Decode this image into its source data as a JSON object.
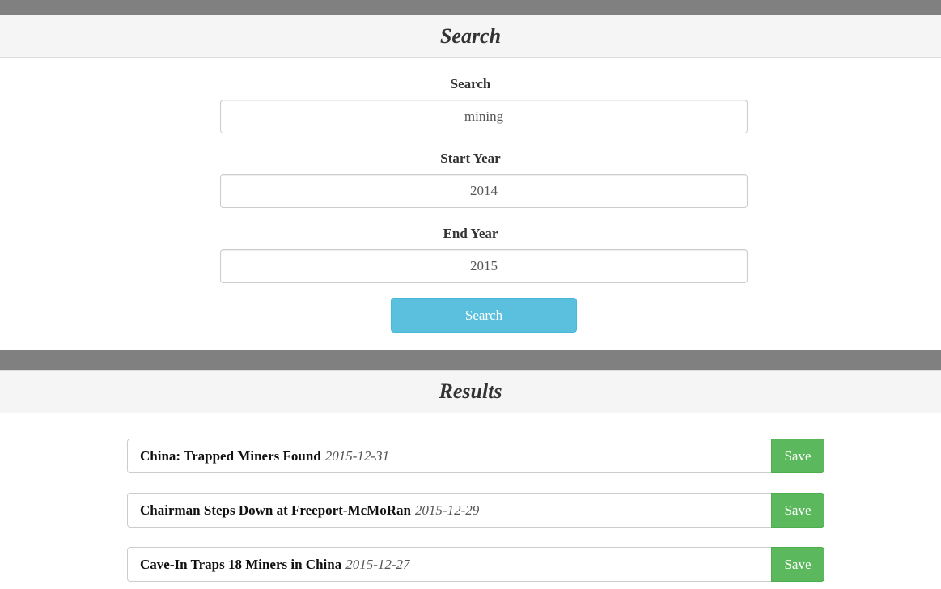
{
  "search_panel": {
    "title": "Search",
    "search_label": "Search",
    "search_value": "mining",
    "start_year_label": "Start Year",
    "start_year_value": "2014",
    "end_year_label": "End Year",
    "end_year_value": "2015",
    "button_label": "Search"
  },
  "results_panel": {
    "title": "Results",
    "save_label": "Save",
    "items": [
      {
        "title": "China: Trapped Miners Found",
        "date": "2015-12-31"
      },
      {
        "title": "Chairman Steps Down at Freeport-McMoRan",
        "date": "2015-12-29"
      },
      {
        "title": "Cave-In Traps 18 Miners in China",
        "date": "2015-12-27"
      }
    ]
  },
  "colors": {
    "info_button": "#5bc0de",
    "success_button": "#5cb85c",
    "divider_bar": "#808080",
    "panel_heading": "#f5f5f5"
  }
}
